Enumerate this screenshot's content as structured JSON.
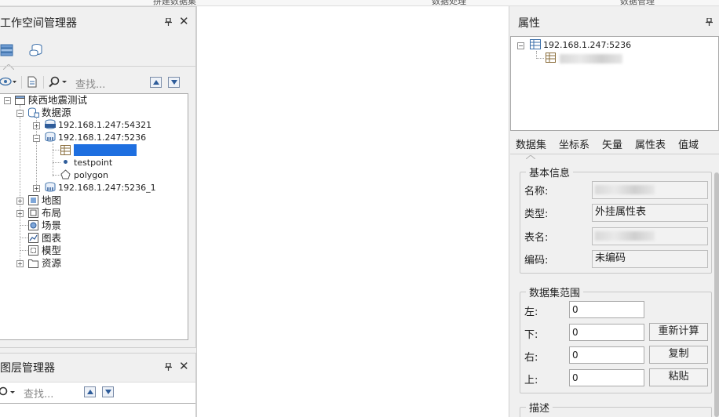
{
  "top_strip": {
    "items": [
      "拼建数据集",
      "数据处理",
      "数据管理"
    ]
  },
  "workspace": {
    "title": "工作空间管理器",
    "search_placeholder": "查找...",
    "tree": {
      "root": "陕西地震测试",
      "datasource_group": "数据源",
      "ds1": "192.168.1.247:54321",
      "ds2": "192.168.1.247:5236",
      "ds2_children": [
        "testpoint",
        "polygon"
      ],
      "ds3": "192.168.1.247:5236_1",
      "map": "地图",
      "layout": "布局",
      "scene": "场景",
      "chart": "图表",
      "model": "模型",
      "resource": "资源"
    }
  },
  "layers": {
    "title": "图层管理器",
    "search_placeholder": "查找..."
  },
  "properties": {
    "title": "属性",
    "tree_root": "192.168.1.247:5236",
    "tabs": [
      "数据集",
      "坐标系",
      "矢量",
      "属性表",
      "值域"
    ],
    "basic": {
      "title": "基本信息",
      "name_label": "名称:",
      "type_label": "类型:",
      "type_value": "外挂属性表",
      "table_label": "表名:",
      "code_label": "编码:",
      "code_value": "未编码"
    },
    "bounds": {
      "title": "数据集范围",
      "left_label": "左:",
      "bottom_label": "下:",
      "right_label": "右:",
      "top_label": "上:",
      "left_value": "0",
      "bottom_value": "0",
      "right_value": "0",
      "top_value": "0",
      "recalc_button": "重新计算",
      "copy_button": "复制",
      "paste_button": "粘贴"
    },
    "description_title": "描述"
  }
}
